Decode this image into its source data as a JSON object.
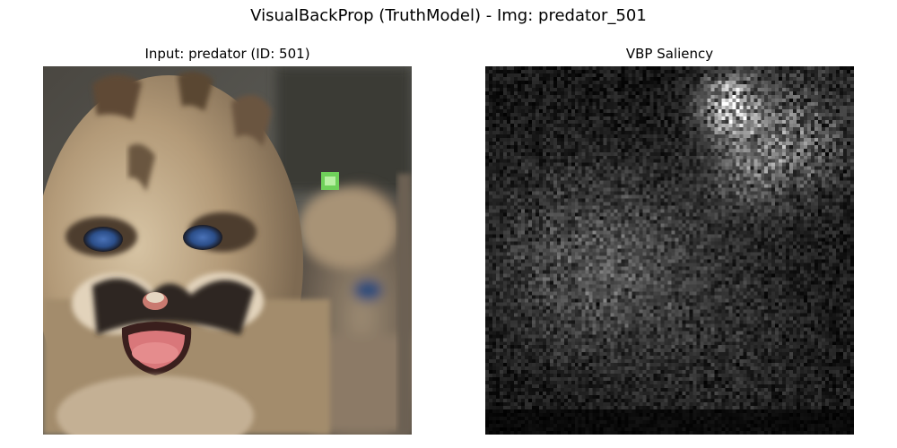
{
  "figure": {
    "suptitle": "VisualBackProp (TruthModel) - Img: predator_501"
  },
  "panels": [
    {
      "title": "Input: predator (ID: 501)",
      "content": "cougar-cub-photo"
    },
    {
      "title": "VBP Saliency",
      "content": "grayscale-saliency-map"
    }
  ],
  "colors": {
    "background": "#ffffff",
    "saliency_background": "#050505",
    "fur": "#b39a78",
    "eye": "#2c4f8a",
    "mouth": "#d9777a",
    "green_highlight": "#6fd15a"
  }
}
